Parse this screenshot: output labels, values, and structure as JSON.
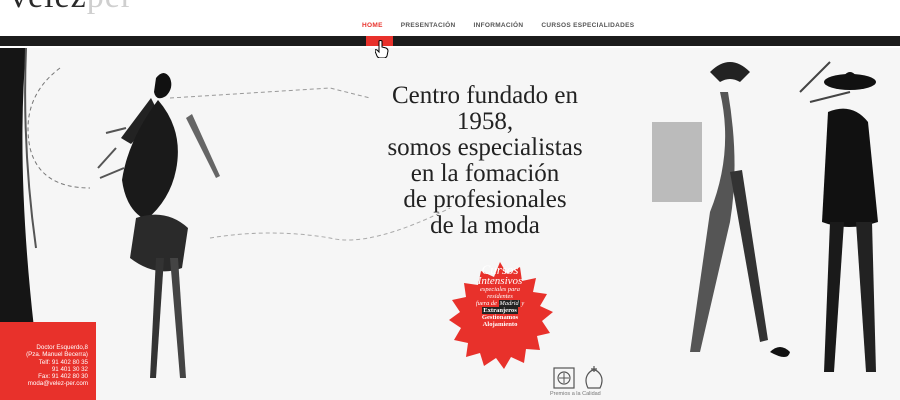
{
  "brand": {
    "logo_dark": "velez",
    "logo_light": "per"
  },
  "nav": {
    "items": [
      "HOME",
      "PRESENTACIÓN",
      "INFORMACIÓN",
      "CURSOS ESPECIALIDADES"
    ],
    "active": "HOME"
  },
  "headline": {
    "lines": [
      "Centro fundado en",
      "1958,",
      "somos especialistas",
      "en la fomación",
      "de profesionales",
      "de la moda"
    ]
  },
  "badge": {
    "title": "Cursos",
    "subtitle": "Intensivos",
    "line1": "especiales para",
    "line2": "residentes",
    "line3_pre": "fuera de",
    "line3_hl": "Madrid",
    "line3_post": "y",
    "line4": "Extranjeros",
    "line5": "Gestionamos",
    "line6": "Alojamiento"
  },
  "contact": {
    "address1": "Doctor Esquerdo,8",
    "address2": "(Pza. Manuel Becerra)",
    "tel1": "Telf: 91 402 80 35",
    "tel2": "91 401 30 32",
    "fax": "Fax: 91 402 80 30",
    "email": "moda@velez-per.com"
  },
  "awards": {
    "label": "Premios a la Calidad"
  },
  "colors": {
    "accent": "#e8312b",
    "bar": "#1c1c1c",
    "text": "#222222"
  },
  "icons": [
    "cursor-hand-icon",
    "award-seal-icon",
    "award-crest-icon"
  ]
}
